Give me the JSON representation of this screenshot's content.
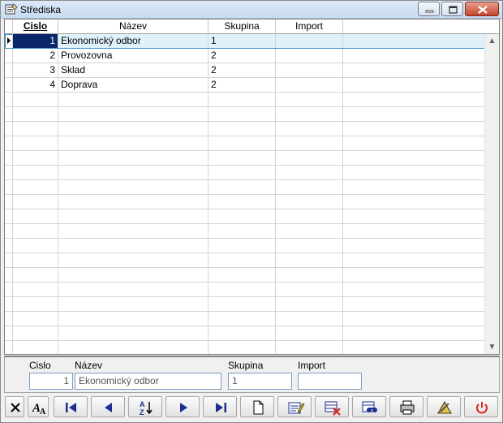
{
  "window": {
    "title": "Střediska"
  },
  "columns": {
    "cislo": "Cislo",
    "nazev": "Název",
    "skupina": "Skupina",
    "import": "Import"
  },
  "rows": [
    {
      "cislo": "1",
      "nazev": "Ekonomický odbor",
      "skupina": "1",
      "import": ""
    },
    {
      "cislo": "2",
      "nazev": "Provozovna",
      "skupina": "2",
      "import": ""
    },
    {
      "cislo": "3",
      "nazev": "Sklad",
      "skupina": "2",
      "import": ""
    },
    {
      "cislo": "4",
      "nazev": "Doprava",
      "skupina": "2",
      "import": ""
    }
  ],
  "selected_row_index": 0,
  "detail": {
    "cislo_label": "Cislo",
    "cislo_value": "1",
    "nazev_label": "Název",
    "nazev_value": "Ekonomický odbor",
    "skupina_label": "Skupina",
    "skupina_value": "1",
    "import_label": "Import",
    "import_value": ""
  },
  "toolbar": {
    "buttons": [
      {
        "name": "close-icon"
      },
      {
        "name": "font-icon"
      },
      {
        "name": "first-record-icon"
      },
      {
        "name": "previous-record-icon"
      },
      {
        "name": "sort-icon"
      },
      {
        "name": "next-record-icon"
      },
      {
        "name": "last-record-icon"
      },
      {
        "name": "new-record-icon"
      },
      {
        "name": "edit-record-icon"
      },
      {
        "name": "delete-record-icon"
      },
      {
        "name": "search-icon"
      },
      {
        "name": "print-icon"
      },
      {
        "name": "tools-icon"
      },
      {
        "name": "power-icon"
      }
    ]
  },
  "colors": {
    "selection": "#0a2868",
    "row_highlight": "#dff1fa",
    "power": "#d9261c",
    "accent": "#1c2f8f"
  }
}
